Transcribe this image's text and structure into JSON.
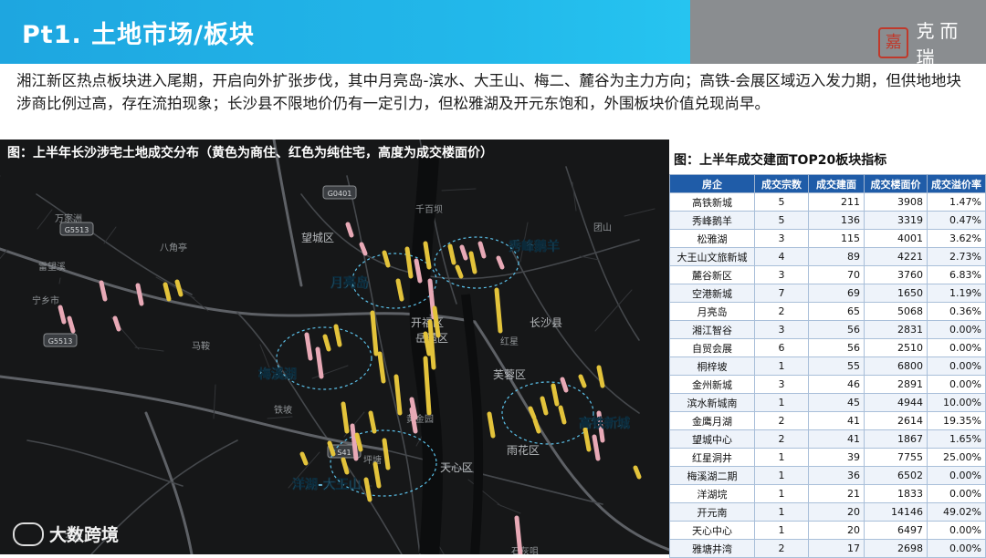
{
  "header": {
    "title": "Pt1. 土地市场/板块",
    "brand_seal": "嘉",
    "brand_text": "克而瑞"
  },
  "summary": "湘江新区热点板块进入尾期，开启向外扩张步伐，其中月亮岛-滨水、大王山、梅二、麓谷为主力方向；高铁-会展区域迈入发力期，但供地地块涉商比例过高，存在流拍现象；长沙县不限地价仍有一定引力，但松雅湖及开元东饱和，外围板块价值兑现尚早。",
  "map": {
    "caption": "图：上半年长沙涉宅土地成交分布（黄色为商住、红色为纯住宅，高度为成交楼面价）",
    "clusters": [
      "秀峰鹅羊",
      "月亮岛",
      "梅溪湖",
      "高铁新城",
      "洋湖-大王山"
    ],
    "districts": [
      "望城区",
      "开福区",
      "岳麓区",
      "长沙县",
      "芙蓉区",
      "雨花区",
      "天心区"
    ],
    "places": [
      "万家洲",
      "八角亭",
      "宁乡市",
      "雷望溪",
      "千百坝",
      "红星",
      "团山",
      "黄金园",
      "坪塘",
      "三塘",
      "石灰咀",
      "铁坡",
      "马鞍"
    ],
    "road_shields": [
      "G5513",
      "G5513",
      "G0401",
      "S41"
    ],
    "colors": {
      "commercial": "#e3c33b",
      "residential": "#e8a9b6",
      "circle": "#5cc3ec"
    }
  },
  "table": {
    "caption": "图：上半年成交建面TOP20板块指标",
    "headers": [
      "房企",
      "成交宗数",
      "成交建面",
      "成交楼面价",
      "成交溢价率"
    ],
    "rows": [
      [
        "高铁新城",
        "5",
        "211",
        "3908",
        "1.47%"
      ],
      [
        "秀峰鹅羊",
        "5",
        "136",
        "3319",
        "0.47%"
      ],
      [
        "松雅湖",
        "3",
        "115",
        "4001",
        "3.62%"
      ],
      [
        "大王山文旅新城",
        "4",
        "89",
        "4221",
        "2.73%"
      ],
      [
        "麓谷新区",
        "3",
        "70",
        "3760",
        "6.83%"
      ],
      [
        "空港新城",
        "7",
        "69",
        "1650",
        "1.19%"
      ],
      [
        "月亮岛",
        "2",
        "65",
        "5068",
        "0.36%"
      ],
      [
        "湘江智谷",
        "3",
        "56",
        "2831",
        "0.00%"
      ],
      [
        "自贸会展",
        "6",
        "56",
        "2510",
        "0.00%"
      ],
      [
        "桐梓坡",
        "1",
        "55",
        "6800",
        "0.00%"
      ],
      [
        "金州新城",
        "3",
        "46",
        "2891",
        "0.00%"
      ],
      [
        "滨水新城南",
        "1",
        "45",
        "4944",
        "10.00%"
      ],
      [
        "金鹰月湖",
        "2",
        "41",
        "2614",
        "19.35%"
      ],
      [
        "望城中心",
        "2",
        "41",
        "1867",
        "1.65%"
      ],
      [
        "红星洞井",
        "1",
        "39",
        "7755",
        "25.00%"
      ],
      [
        "梅溪湖二期",
        "1",
        "36",
        "6502",
        "0.00%"
      ],
      [
        "洋湖垸",
        "1",
        "21",
        "1833",
        "0.00%"
      ],
      [
        "开元南",
        "1",
        "20",
        "14146",
        "49.02%"
      ],
      [
        "天心中心",
        "1",
        "20",
        "6497",
        "0.00%"
      ],
      [
        "雅塘井湾",
        "2",
        "17",
        "2698",
        "0.00%"
      ]
    ]
  },
  "watermark": "大数跨境"
}
